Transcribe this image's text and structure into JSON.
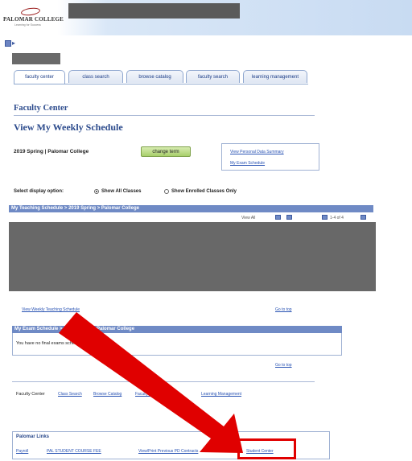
{
  "header": {
    "logo_text": "PALOMAR COLLEGE",
    "logo_tagline": "Learning for Success"
  },
  "tabs": [
    "faculty center",
    "class search",
    "browse catalog",
    "faculty search",
    "learning management"
  ],
  "section_label": "Faculty Center",
  "page_title": "View My Weekly Schedule",
  "term": "2019 Spring | Palomar College",
  "change_term_label": "change term",
  "side_links": [
    "View Personal Data Summary",
    "My Exam Schedule"
  ],
  "display_option": {
    "label": "Select display option:",
    "options": [
      "Show All Classes",
      "Show Enrolled Classes Only"
    ],
    "selected": "Show All Classes"
  },
  "teaching_schedule_bar": "My Teaching Schedule > 2019 Spring > Palomar College",
  "pager_text": "View All",
  "pager_range": "1-4 of 4",
  "view_weekly_link": "View Weekly Teaching Schedule",
  "go_to_top": "Go to top",
  "exam_bar": "My Exam Schedule > 2019 Spring > Palomar College",
  "exam_message": "You have no final exams scheduled at this time.",
  "footer": {
    "label": "Faculty Center",
    "links": [
      "Class Search",
      "Browse Catalog",
      "Faculty Search",
      "Learning Management"
    ]
  },
  "palomar_links": {
    "title": "Palomar Links",
    "links": [
      "Payroll",
      "PAL STUDENT COURSE FEE",
      "View/Print Previous PD Contracts",
      "Student Center"
    ]
  },
  "colors": {
    "accent": "#6f8ac5",
    "highlight": "#e00000",
    "title": "#2b4a8c"
  }
}
